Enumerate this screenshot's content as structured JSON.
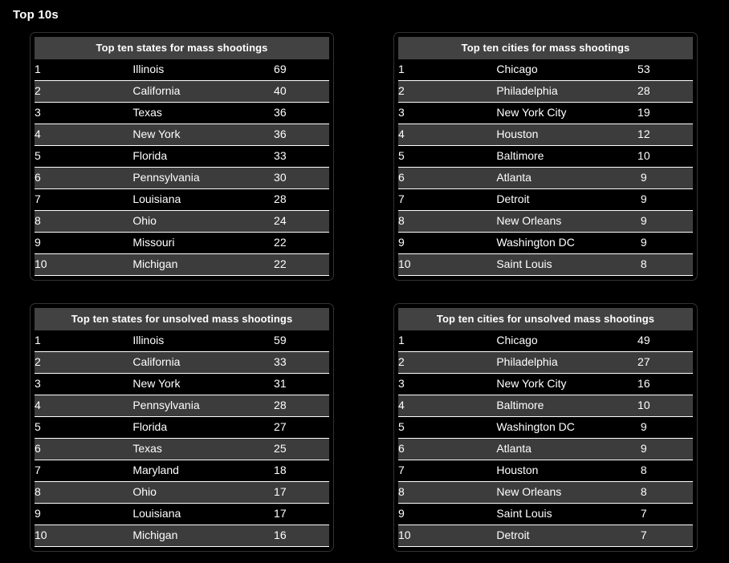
{
  "page": {
    "title": "Top 10s",
    "background_color": "#000000",
    "card_border_color": "#333333",
    "header_row_color": "#424242",
    "striped_row_color": "#3c3c3c",
    "text_color": "#ffffff"
  },
  "tables": [
    {
      "id": "top-states-mass-shootings",
      "header": "Top ten states for mass shootings",
      "rows": [
        {
          "rank": "1",
          "name": "Illinois",
          "value": "69"
        },
        {
          "rank": "2",
          "name": "California",
          "value": "40"
        },
        {
          "rank": "3",
          "name": "Texas",
          "value": "36"
        },
        {
          "rank": "4",
          "name": "New York",
          "value": "36"
        },
        {
          "rank": "5",
          "name": "Florida",
          "value": "33"
        },
        {
          "rank": "6",
          "name": "Pennsylvania",
          "value": "30"
        },
        {
          "rank": "7",
          "name": "Louisiana",
          "value": "28"
        },
        {
          "rank": "8",
          "name": "Ohio",
          "value": "24"
        },
        {
          "rank": "9",
          "name": "Missouri",
          "value": "22"
        },
        {
          "rank": "10",
          "name": "Michigan",
          "value": "22"
        }
      ]
    },
    {
      "id": "top-cities-mass-shootings",
      "header": "Top ten cities for mass shootings",
      "rows": [
        {
          "rank": "1",
          "name": "Chicago",
          "value": "53"
        },
        {
          "rank": "2",
          "name": "Philadelphia",
          "value": "28"
        },
        {
          "rank": "3",
          "name": "New York City",
          "value": "19"
        },
        {
          "rank": "4",
          "name": "Houston",
          "value": "12"
        },
        {
          "rank": "5",
          "name": "Baltimore",
          "value": "10"
        },
        {
          "rank": "6",
          "name": "Atlanta",
          "value": "9"
        },
        {
          "rank": "7",
          "name": "Detroit",
          "value": "9"
        },
        {
          "rank": "8",
          "name": "New Orleans",
          "value": "9"
        },
        {
          "rank": "9",
          "name": "Washington DC",
          "value": "9"
        },
        {
          "rank": "10",
          "name": "Saint Louis",
          "value": "8"
        }
      ]
    },
    {
      "id": "top-states-unsolved-mass-shootings",
      "header": "Top ten states for unsolved mass shootings",
      "rows": [
        {
          "rank": "1",
          "name": "Illinois",
          "value": "59"
        },
        {
          "rank": "2",
          "name": "California",
          "value": "33"
        },
        {
          "rank": "3",
          "name": "New York",
          "value": "31"
        },
        {
          "rank": "4",
          "name": "Pennsylvania",
          "value": "28"
        },
        {
          "rank": "5",
          "name": "Florida",
          "value": "27"
        },
        {
          "rank": "6",
          "name": "Texas",
          "value": "25"
        },
        {
          "rank": "7",
          "name": "Maryland",
          "value": "18"
        },
        {
          "rank": "8",
          "name": "Ohio",
          "value": "17"
        },
        {
          "rank": "9",
          "name": "Louisiana",
          "value": "17"
        },
        {
          "rank": "10",
          "name": "Michigan",
          "value": "16"
        }
      ]
    },
    {
      "id": "top-cities-unsolved-mass-shootings",
      "header": "Top ten cities for unsolved mass shootings",
      "rows": [
        {
          "rank": "1",
          "name": "Chicago",
          "value": "49"
        },
        {
          "rank": "2",
          "name": "Philadelphia",
          "value": "27"
        },
        {
          "rank": "3",
          "name": "New York City",
          "value": "16"
        },
        {
          "rank": "4",
          "name": "Baltimore",
          "value": "10"
        },
        {
          "rank": "5",
          "name": "Washington DC",
          "value": "9"
        },
        {
          "rank": "6",
          "name": "Atlanta",
          "value": "9"
        },
        {
          "rank": "7",
          "name": "Houston",
          "value": "8"
        },
        {
          "rank": "8",
          "name": "New Orleans",
          "value": "8"
        },
        {
          "rank": "9",
          "name": "Saint Louis",
          "value": "7"
        },
        {
          "rank": "10",
          "name": "Detroit",
          "value": "7"
        }
      ]
    }
  ]
}
